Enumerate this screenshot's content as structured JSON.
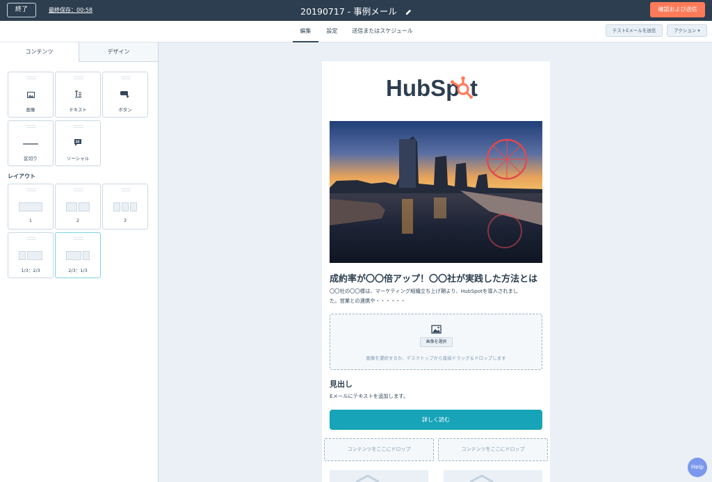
{
  "topbar": {
    "exit_label": "終了",
    "last_saved": "最終保存：00:58",
    "email_title": "20190717 - 事例メール",
    "review_send_label": "確認および送信"
  },
  "subnav": {
    "tabs": [
      {
        "label": "編集",
        "active": true
      },
      {
        "label": "設定",
        "active": false
      },
      {
        "label": "送信またはスケジュール",
        "active": false
      }
    ],
    "test_email_label": "テストEメールを送信",
    "actions_label": "アクション ▾"
  },
  "sidebar": {
    "tabs": [
      "コンテンツ",
      "デザイン"
    ],
    "modules": [
      {
        "label": "画像",
        "icon": "image-icon"
      },
      {
        "label": "テキスト",
        "icon": "text-icon"
      },
      {
        "label": "ボタン",
        "icon": "button-icon"
      },
      {
        "label": "区切り",
        "icon": "divider-icon"
      },
      {
        "label": "ソーシャル",
        "icon": "social-icon"
      }
    ],
    "layout_heading": "レイアウト",
    "layouts": [
      "1",
      "2",
      "3",
      "1/3：2/3",
      "2/3：1/3"
    ]
  },
  "email": {
    "logo_text": "HubSpot",
    "headline": "成約率が〇〇倍アップ！〇〇社が実践した方法とは",
    "body_line1": "〇〇社の〇〇様は、マーケティング組織立ち上げ期より、HubSpotを導入されまし",
    "body_line2": "た。営業との連携や・・・・・・",
    "select_image_label": "画像を選択",
    "drop_hint": "画像を選択するか、デスクトップから直接ドラッグ＆ドロップします",
    "subheading": "見出し",
    "sub_text": "Eメールにテキストを追加します。",
    "cta_label": "詳しく読む",
    "drop_zone_label": "コンテンツをここにドロップ"
  },
  "help_label": "Help",
  "colors": {
    "topbar": "#2d3e50",
    "accent": "#ff7a59",
    "cta": "#18a4b8",
    "help": "#7b98ec"
  }
}
